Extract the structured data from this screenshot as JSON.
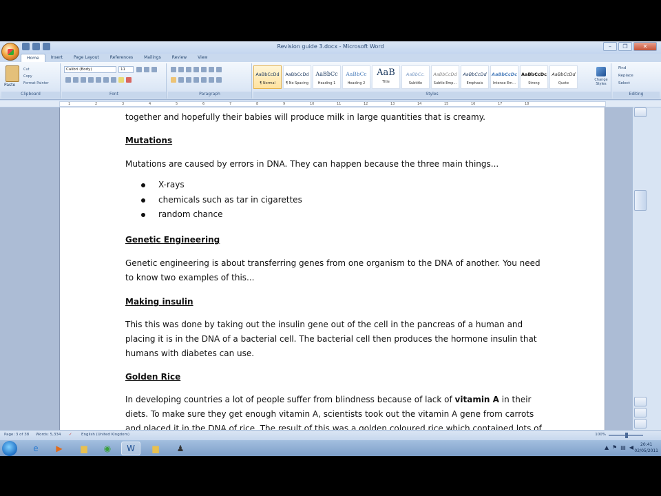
{
  "window": {
    "title": "Revision guide 3.docx - Microsoft Word",
    "controls": [
      "–",
      "❐",
      "✕"
    ]
  },
  "tabs": [
    "Home",
    "Insert",
    "Page Layout",
    "References",
    "Mailings",
    "Review",
    "View"
  ],
  "ribbon": {
    "clipboard": {
      "paste": "Paste",
      "cut": "Cut",
      "copy": "Copy",
      "format_painter": "Format Painter",
      "label": "Clipboard"
    },
    "font": {
      "name": "Calibri (Body)",
      "size": "11",
      "label": "Font"
    },
    "paragraph": {
      "label": "Paragraph"
    },
    "styles": {
      "label": "Styles",
      "items": [
        {
          "preview": "AaBbCcDd",
          "name": "¶ Normal"
        },
        {
          "preview": "AaBbCcDd",
          "name": "¶ No Spacing"
        },
        {
          "preview": "AaBbCc",
          "name": "Heading 1"
        },
        {
          "preview": "AaBbCc",
          "name": "Heading 2"
        },
        {
          "preview": "AaB",
          "name": "Title"
        },
        {
          "preview": "AaBbCc.",
          "name": "Subtitle"
        },
        {
          "preview": "AaBbCcDd",
          "name": "Subtle Emp..."
        },
        {
          "preview": "AaBbCcDd",
          "name": "Emphasis"
        },
        {
          "preview": "AaBbCcDc",
          "name": "Intense Em..."
        },
        {
          "preview": "AaBbCcDc",
          "name": "Strong"
        },
        {
          "preview": "AaBbCcDd",
          "name": "Quote"
        }
      ],
      "change_styles": "Change Styles"
    },
    "editing": {
      "find": "Find",
      "replace": "Replace",
      "select": "Select",
      "label": "Editing"
    }
  },
  "ruler": {
    "numbers": [
      "1",
      "2",
      "3",
      "4",
      "5",
      "6",
      "7",
      "8",
      "9",
      "10",
      "11",
      "12",
      "13",
      "14",
      "15",
      "16",
      "17",
      "18"
    ]
  },
  "document": {
    "line_top": "together and hopefully their babies will produce milk in large quantities that is creamy.",
    "h_mutations": "Mutations",
    "p_mutations": "Mutations are caused by errors in DNA. They can happen because the three main things...",
    "bullets": [
      "X-rays",
      "chemicals such as tar in cigarettes",
      "random chance"
    ],
    "h_genetic": "Genetic Engineering",
    "p_genetic_1": "Genetic engineering is about transferring genes from one organism to the DNA of another. You need",
    "p_genetic_2": "to know two examples of this...",
    "h_insulin": "Making insulin",
    "p_insulin_1": "This this was done by taking out the insulin gene out of the cell in the pancreas of a human and",
    "p_insulin_2": "placing it is in the DNA of a bacterial cell. The bacterial cell then produces the hormone insulin that",
    "p_insulin_3": "humans with diabetes can use.",
    "h_rice": "Golden Rice",
    "p_rice_1a": "In developing countries a lot of people suffer from blindness because of lack of ",
    "p_rice_1b": "vitamin A",
    "p_rice_1c": " in their",
    "p_rice_2": "diets. To make sure they get enough vitamin A, scientists took out the vitamin A gene from carrots",
    "p_rice_3": "and placed it in the DNA of rice. The result of this was a golden coloured rice which contained lots of"
  },
  "status": {
    "page": "Page: 3 of 38",
    "words": "Words: 5,334",
    "language": "English (United Kingdom)",
    "zoom": "100%"
  },
  "taskbar": {
    "clock_time": "20:41",
    "clock_date": "02/05/2011"
  }
}
